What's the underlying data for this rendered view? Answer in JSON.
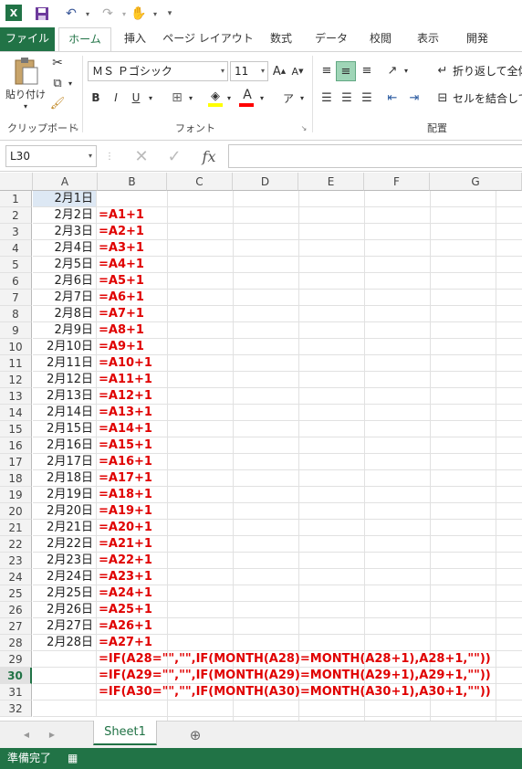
{
  "qat": {
    "undo_icon": "undo-icon",
    "redo_icon": "redo-icon"
  },
  "tabs": {
    "file": "ファイル",
    "items": [
      "ホーム",
      "挿入",
      "ページ レイアウト",
      "数式",
      "データ",
      "校閲",
      "表示",
      "開発"
    ]
  },
  "ribbon": {
    "paste_label": "貼り付け",
    "clipboard_label": "クリップボード",
    "font_name": "ＭＳ Ｐゴシック",
    "font_size": "11",
    "font_label": "フォント",
    "bold": "B",
    "italic": "I",
    "underline": "U",
    "wrap_text": "折り返して全体を",
    "merge_cells": "セルを結合して中",
    "alignment_label": "配置"
  },
  "formula_bar": {
    "name_box": "L30",
    "fx": "fx",
    "formula": ""
  },
  "grid": {
    "columns": [
      "A",
      "B",
      "C",
      "D",
      "E",
      "F",
      "G"
    ],
    "rows": [
      {
        "n": "1",
        "a": "2月1日",
        "b": ""
      },
      {
        "n": "2",
        "a": "2月2日",
        "b": "=A1+1"
      },
      {
        "n": "3",
        "a": "2月3日",
        "b": "=A2+1"
      },
      {
        "n": "4",
        "a": "2月4日",
        "b": "=A3+1"
      },
      {
        "n": "5",
        "a": "2月5日",
        "b": "=A4+1"
      },
      {
        "n": "6",
        "a": "2月6日",
        "b": "=A5+1"
      },
      {
        "n": "7",
        "a": "2月7日",
        "b": "=A6+1"
      },
      {
        "n": "8",
        "a": "2月8日",
        "b": "=A7+1"
      },
      {
        "n": "9",
        "a": "2月9日",
        "b": "=A8+1"
      },
      {
        "n": "10",
        "a": "2月10日",
        "b": "=A9+1"
      },
      {
        "n": "11",
        "a": "2月11日",
        "b": "=A10+1"
      },
      {
        "n": "12",
        "a": "2月12日",
        "b": "=A11+1"
      },
      {
        "n": "13",
        "a": "2月13日",
        "b": "=A12+1"
      },
      {
        "n": "14",
        "a": "2月14日",
        "b": "=A13+1"
      },
      {
        "n": "15",
        "a": "2月15日",
        "b": "=A14+1"
      },
      {
        "n": "16",
        "a": "2月16日",
        "b": "=A15+1"
      },
      {
        "n": "17",
        "a": "2月17日",
        "b": "=A16+1"
      },
      {
        "n": "18",
        "a": "2月18日",
        "b": "=A17+1"
      },
      {
        "n": "19",
        "a": "2月19日",
        "b": "=A18+1"
      },
      {
        "n": "20",
        "a": "2月20日",
        "b": "=A19+1"
      },
      {
        "n": "21",
        "a": "2月21日",
        "b": "=A20+1"
      },
      {
        "n": "22",
        "a": "2月22日",
        "b": "=A21+1"
      },
      {
        "n": "23",
        "a": "2月23日",
        "b": "=A22+1"
      },
      {
        "n": "24",
        "a": "2月24日",
        "b": "=A23+1"
      },
      {
        "n": "25",
        "a": "2月25日",
        "b": "=A24+1"
      },
      {
        "n": "26",
        "a": "2月26日",
        "b": "=A25+1"
      },
      {
        "n": "27",
        "a": "2月27日",
        "b": "=A26+1"
      },
      {
        "n": "28",
        "a": "2月28日",
        "b": "=A27+1"
      },
      {
        "n": "29",
        "a": "",
        "b": "=IF(A28=\"\",\"\",IF(MONTH(A28)=MONTH(A28+1),A28+1,\"\"))"
      },
      {
        "n": "30",
        "a": "",
        "b": "=IF(A29=\"\",\"\",IF(MONTH(A29)=MONTH(A29+1),A29+1,\"\"))"
      },
      {
        "n": "31",
        "a": "",
        "b": "=IF(A30=\"\",\"\",IF(MONTH(A30)=MONTH(A30+1),A30+1,\"\"))"
      },
      {
        "n": "32",
        "a": "",
        "b": ""
      }
    ],
    "selected_row": "30"
  },
  "sheet_tabs": {
    "active": "Sheet1",
    "add_icon": "plus-circle-icon"
  },
  "status": {
    "text": "準備完了"
  },
  "colors": {
    "excel_green": "#217346",
    "formula_red": "#e00000",
    "selected_cell": "#dde8f4"
  }
}
